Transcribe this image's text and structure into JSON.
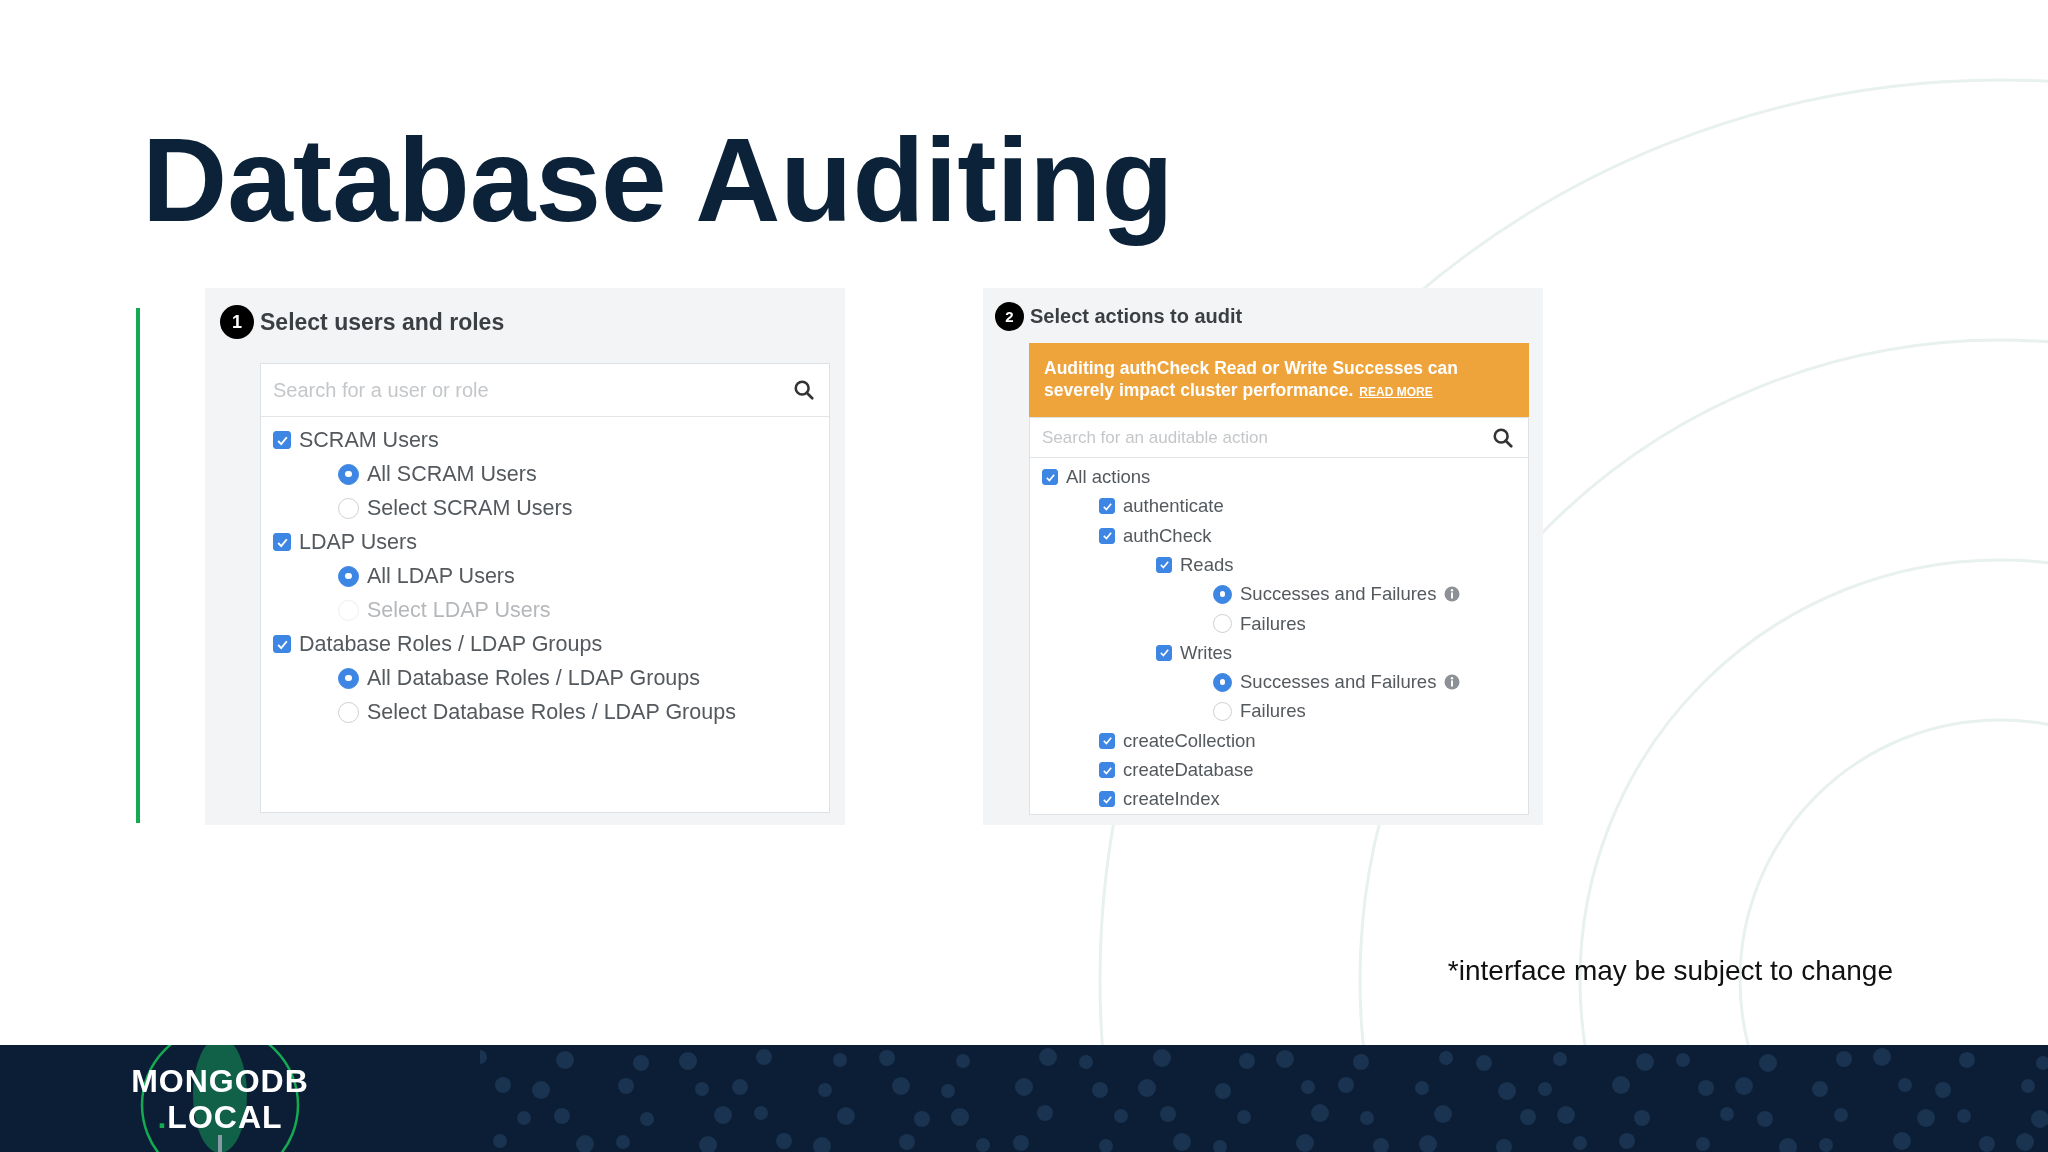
{
  "title": "Database Auditing",
  "panels": [
    {
      "step": "1",
      "heading": "Select users and roles",
      "search": {
        "placeholder": "Search for a user or role"
      },
      "items": [
        {
          "kind": "checkbox",
          "label": "SCRAM Users",
          "checked": true,
          "children": [
            {
              "kind": "radio",
              "label": "All SCRAM Users",
              "selected": true,
              "disabled": false,
              "info": false
            },
            {
              "kind": "radio",
              "label": "Select SCRAM Users",
              "selected": false,
              "disabled": false,
              "info": false
            }
          ]
        },
        {
          "kind": "checkbox",
          "label": "LDAP Users",
          "checked": true,
          "children": [
            {
              "kind": "radio",
              "label": "All LDAP Users",
              "selected": true,
              "disabled": false,
              "info": false
            },
            {
              "kind": "radio",
              "label": "Select LDAP Users",
              "selected": false,
              "disabled": true,
              "info": false
            }
          ]
        },
        {
          "kind": "checkbox",
          "label": "Database Roles / LDAP Groups",
          "checked": true,
          "children": [
            {
              "kind": "radio",
              "label": "All Database Roles / LDAP Groups",
              "selected": true,
              "disabled": false,
              "info": false
            },
            {
              "kind": "radio",
              "label": "Select Database Roles / LDAP Groups",
              "selected": false,
              "disabled": false,
              "info": false
            }
          ]
        }
      ]
    },
    {
      "step": "2",
      "heading": "Select actions to audit",
      "banner": {
        "text": "Auditing authCheck Read or Write Successes can severely impact cluster performance.",
        "link": "READ MORE"
      },
      "search": {
        "placeholder": "Search for an auditable action"
      },
      "items": [
        {
          "kind": "checkbox",
          "label": "All actions",
          "checked": true,
          "children": [
            {
              "kind": "checkbox",
              "label": "authenticate",
              "checked": true
            },
            {
              "kind": "checkbox",
              "label": "authCheck",
              "checked": true,
              "children": [
                {
                  "kind": "checkbox",
                  "label": "Reads",
                  "checked": true,
                  "children": [
                    {
                      "kind": "radio",
                      "label": "Successes and Failures",
                      "selected": true,
                      "disabled": false,
                      "info": true
                    },
                    {
                      "kind": "radio",
                      "label": "Failures",
                      "selected": false,
                      "disabled": false,
                      "info": false
                    }
                  ]
                },
                {
                  "kind": "checkbox",
                  "label": "Writes",
                  "checked": true,
                  "children": [
                    {
                      "kind": "radio",
                      "label": "Successes and Failures",
                      "selected": true,
                      "disabled": false,
                      "info": true
                    },
                    {
                      "kind": "radio",
                      "label": "Failures",
                      "selected": false,
                      "disabled": false,
                      "info": false
                    }
                  ]
                }
              ]
            },
            {
              "kind": "checkbox",
              "label": "createCollection",
              "checked": true
            },
            {
              "kind": "checkbox",
              "label": "createDatabase",
              "checked": true
            },
            {
              "kind": "checkbox",
              "label": "createIndex",
              "checked": true
            }
          ]
        }
      ]
    }
  ],
  "footnote": "*interface may be subject to change",
  "logo": {
    "line_1": "MONGODB",
    "line_2": ".LOCAL"
  }
}
